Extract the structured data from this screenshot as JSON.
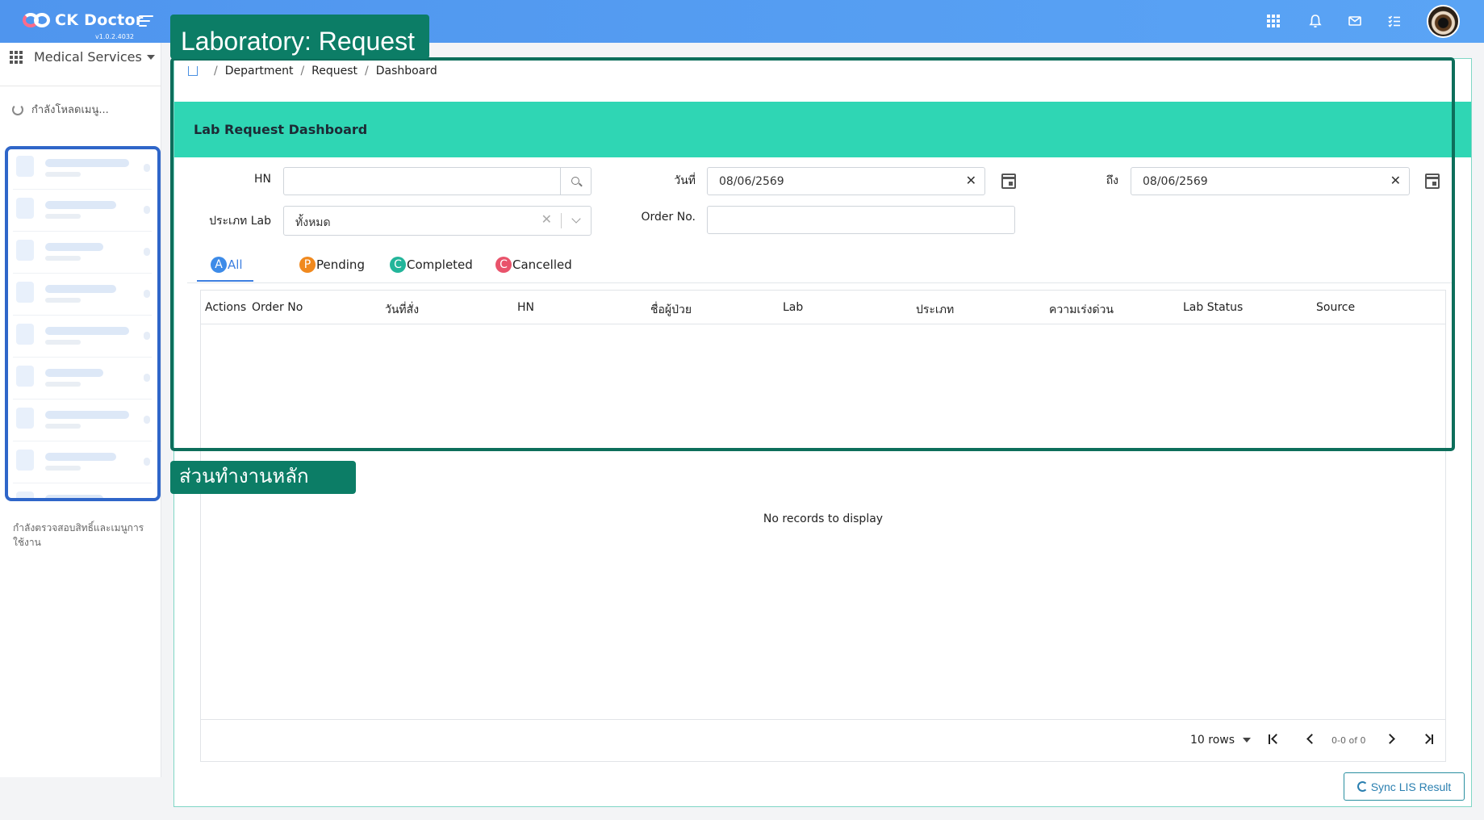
{
  "app": {
    "name": "CK Doctor",
    "version": "v1.0.2.4032"
  },
  "annotations": {
    "top_label": "Laboratory: Request",
    "bottom_label": "ส่วนทำงานหลัก"
  },
  "sidebar": {
    "module": "Medical Services",
    "loading_text": "กำลังโหลดเมนู...",
    "note": "กำลังตรวจสอบสิทธิ์และเมนูการใช้งาน"
  },
  "breadcrumb": [
    "Department",
    "Request",
    "Dashboard"
  ],
  "page": {
    "title": "Lab Request Dashboard"
  },
  "filters": {
    "hn_label": "HN",
    "hn_value": "",
    "date_label": "วันที่",
    "date_value": "08/06/2569",
    "to_label": "ถึง",
    "to_value": "08/06/2569",
    "lab_type_label": "ประเภท Lab",
    "lab_type_value": "ทั้งหมด",
    "order_no_label": "Order No.",
    "order_no_value": ""
  },
  "tabs": [
    {
      "badge": "A",
      "label": "All",
      "color": "#3d8be8",
      "active": true
    },
    {
      "badge": "P",
      "label": "Pending",
      "color": "#f0891e"
    },
    {
      "badge": "C",
      "label": "Completed",
      "color": "#22b59a"
    },
    {
      "badge": "C",
      "label": "Cancelled",
      "color": "#e9536b"
    }
  ],
  "table": {
    "columns": [
      "Actions",
      "Order No",
      "วันที่สั่ง",
      "HN",
      "ชื่อผู้ป่วย",
      "Lab",
      "ประเภท",
      "ความเร่งด่วน",
      "Lab Status",
      "Source"
    ],
    "rows": [],
    "empty_text": "No records to display"
  },
  "pagination": {
    "rows_per_page": "10 rows",
    "info": "0-0 of 0"
  },
  "actions": {
    "sync_label": "Sync LIS Result"
  },
  "colors": {
    "topbar": "#5aa4f5",
    "header_teal": "#2fd6b4",
    "annotation_green": "#0c7d66",
    "sidebar_highlight": "#2f66c9"
  }
}
